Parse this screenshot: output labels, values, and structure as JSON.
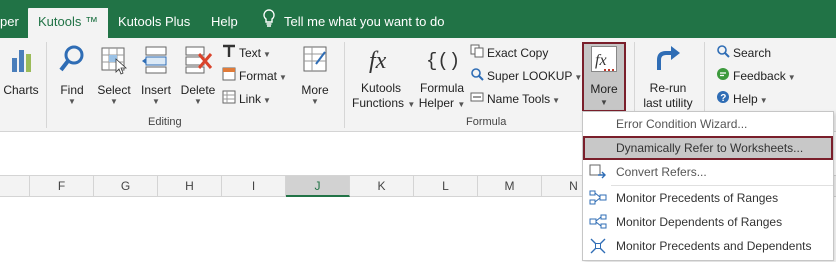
{
  "tabs": [
    {
      "label": "per"
    },
    {
      "label": "Kutools ™"
    },
    {
      "label": "Kutools Plus"
    },
    {
      "label": "Help"
    }
  ],
  "tell_me": "Tell me what you want to do",
  "ribbon": {
    "editing": {
      "label": "Editing",
      "charts": "Charts",
      "find": "Find",
      "select": "Select",
      "insert": "Insert",
      "delete": "Delete",
      "text": "Text",
      "format": "Format",
      "link": "Link",
      "more": "More"
    },
    "formula": {
      "label": "Formula",
      "kutools_functions_1": "Kutools",
      "kutools_functions_2": "Functions",
      "formula_helper_1": "Formula",
      "formula_helper_2": "Helper",
      "exact_copy": "Exact Copy",
      "super_lookup": "Super LOOKUP",
      "name_tools": "Name Tools",
      "more": "More"
    },
    "rerun_1": "Re-run",
    "rerun_2": "last utility",
    "search": "Search",
    "feedback": "Feedback",
    "help": "Help"
  },
  "columns": [
    "F",
    "G",
    "H",
    "I",
    "J",
    "K",
    "L",
    "M",
    "N"
  ],
  "selected_column": "J",
  "menu": {
    "items": [
      {
        "label": "Error Condition Wizard..."
      },
      {
        "label": "Dynamically Refer to Worksheets..."
      },
      {
        "label": "Convert Refers..."
      },
      {
        "label": "Monitor Precedents of Ranges"
      },
      {
        "label": "Monitor Dependents of Ranges"
      },
      {
        "label": "Monitor Precedents and Dependents"
      }
    ]
  },
  "colors": {
    "brand_green": "#217346",
    "highlight_border": "#7a1f2b",
    "ribbon_bg": "#f3f3f3"
  }
}
